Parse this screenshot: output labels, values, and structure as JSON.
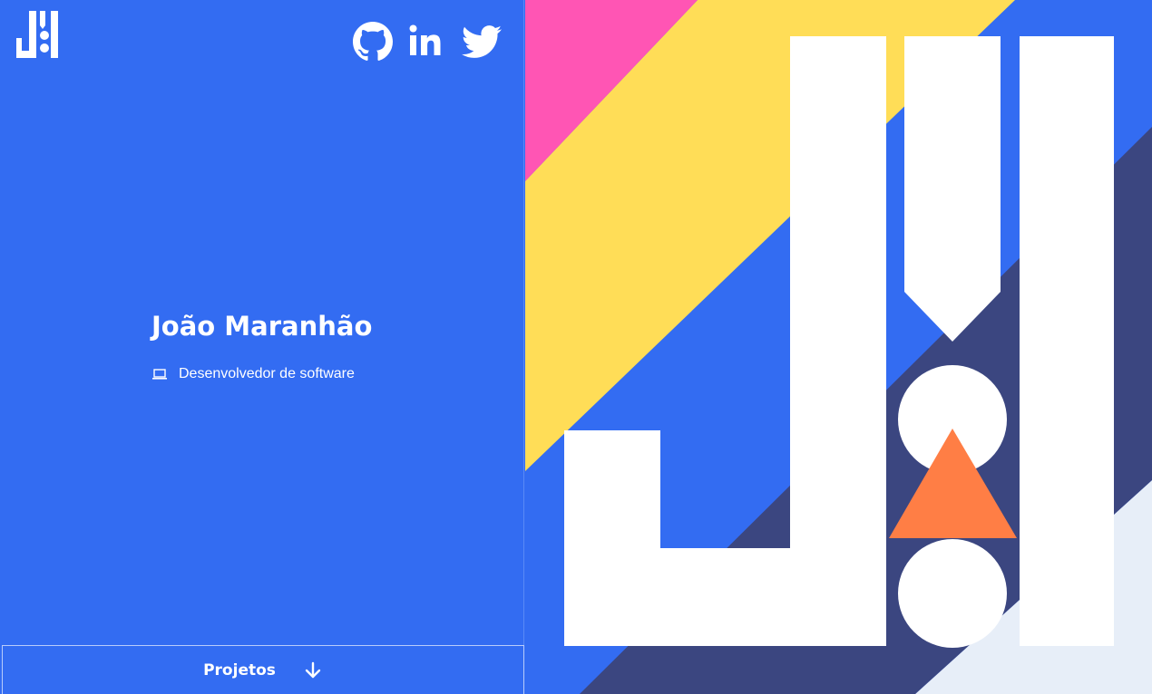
{
  "profile": {
    "name": "João Maranhão",
    "role": "Desenvolvedor de software"
  },
  "icons": {
    "logo": "jm-logo-icon",
    "github": "github-icon",
    "linkedin": "linkedin-icon",
    "twitter": "twitter-icon",
    "role": "laptop-icon",
    "scroll": "arrow-down-icon"
  },
  "footer": {
    "projects_label": "Projetos"
  },
  "colors": {
    "primary_blue": "#336cf2",
    "yellow": "#ffdd57",
    "pink": "#ff55b4",
    "navy": "#3b4680",
    "orange": "#ff7e45",
    "light": "#e7eef8",
    "white": "#ffffff"
  }
}
